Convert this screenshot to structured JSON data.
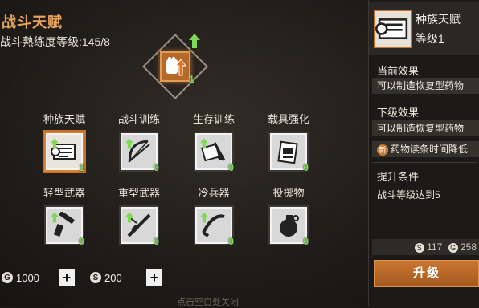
{
  "title": "战斗天赋",
  "subtitle": "战斗熟练度等级:145/8",
  "main_badge": {
    "icon": "fist-arrow-icon",
    "level": "1"
  },
  "talents": [
    {
      "label": "种族天赋",
      "level": "1",
      "icon": "scroll-icon",
      "selected": true
    },
    {
      "label": "战斗训练",
      "level": "0",
      "icon": "bow-icon",
      "selected": false
    },
    {
      "label": "生存训练",
      "level": "0",
      "icon": "survival-kit-icon",
      "selected": false
    },
    {
      "label": "载具强化",
      "level": "0",
      "icon": "vehicle-card-icon",
      "selected": false
    },
    {
      "label": "轻型武器",
      "level": "0",
      "icon": "pistol-icon",
      "selected": false
    },
    {
      "label": "重型武器",
      "level": "0",
      "icon": "rifle-icon",
      "selected": false
    },
    {
      "label": "冷兵器",
      "level": "0",
      "icon": "blade-icon",
      "selected": false
    },
    {
      "label": "投掷物",
      "level": "0",
      "icon": "grenade-icon",
      "selected": false
    }
  ],
  "resources": [
    {
      "icon": "G",
      "value": "1000"
    },
    {
      "icon": "S",
      "value": "200"
    }
  ],
  "hint": "点击空白处关闭",
  "panel": {
    "name": "种族天赋",
    "level": "等级1",
    "current_label": "当前效果",
    "current_effect": "可以制造恢复型药物",
    "next_label": "下级效果",
    "next_effect_1": "可以制造恢复型药物",
    "next_effect_2_badge": "新",
    "next_effect_2": "药物读条时间降低",
    "req_label": "提升条件",
    "req_text": "战斗等级达到5",
    "cost_s": "117",
    "cost_g": "258",
    "upgrade_label": "升级"
  },
  "colors": {
    "accent": "#e8a45f",
    "level": "#7ed957",
    "button": "#c97630"
  }
}
